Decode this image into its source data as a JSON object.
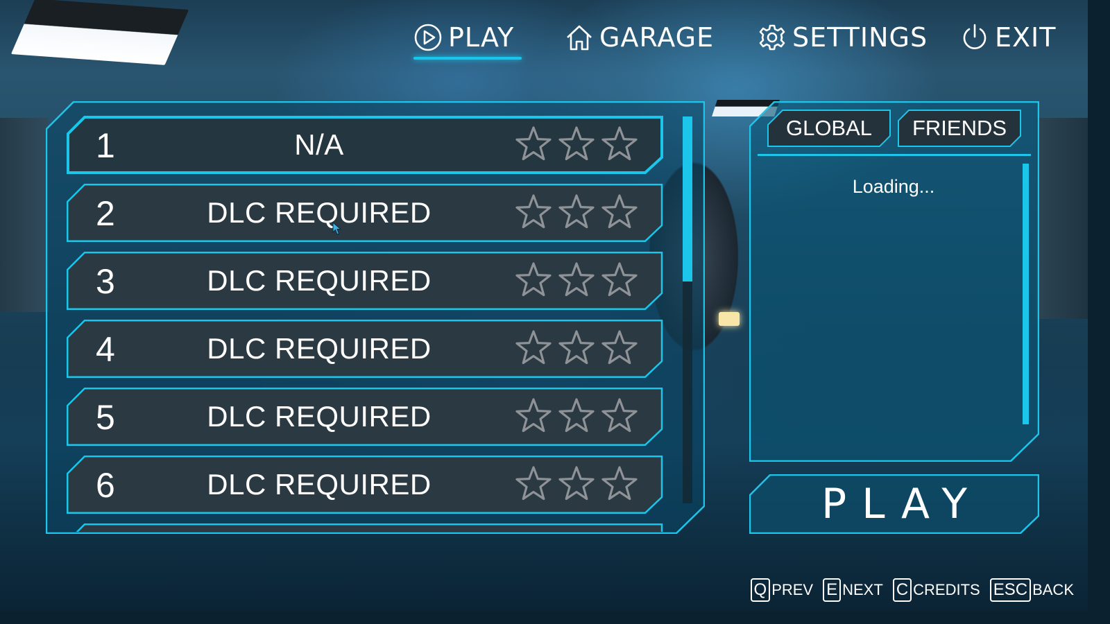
{
  "nav": {
    "items": [
      {
        "label": "PLAY",
        "icon": "play-circle-icon",
        "active": true
      },
      {
        "label": "GARAGE",
        "icon": "home-icon",
        "active": false
      },
      {
        "label": "SETTINGS",
        "icon": "gear-icon",
        "active": false
      },
      {
        "label": "EXIT",
        "icon": "power-icon",
        "active": false
      }
    ]
  },
  "levels": [
    {
      "number": "1",
      "name": "N/A",
      "stars": 0,
      "selected": true
    },
    {
      "number": "2",
      "name": "DLC REQUIRED",
      "stars": 0,
      "selected": false
    },
    {
      "number": "3",
      "name": "DLC REQUIRED",
      "stars": 0,
      "selected": false
    },
    {
      "number": "4",
      "name": "DLC REQUIRED",
      "stars": 0,
      "selected": false
    },
    {
      "number": "5",
      "name": "DLC REQUIRED",
      "stars": 0,
      "selected": false
    },
    {
      "number": "6",
      "name": "DLC REQUIRED",
      "stars": 0,
      "selected": false
    }
  ],
  "leaderboard": {
    "tabs": [
      "GLOBAL",
      "FRIENDS"
    ],
    "status": "Loading..."
  },
  "play_button": {
    "label": "PLAY"
  },
  "hints": [
    {
      "key": "Q",
      "label": "PREV"
    },
    {
      "key": "E",
      "label": "NEXT"
    },
    {
      "key": "C",
      "label": "CREDITS"
    },
    {
      "key": "ESC",
      "label": "BACK"
    }
  ],
  "colors": {
    "accent": "#1bc6ea",
    "row_fill": "#2a3942",
    "row_fill_selected": "#24363f",
    "star_outline": "#8f9397"
  }
}
